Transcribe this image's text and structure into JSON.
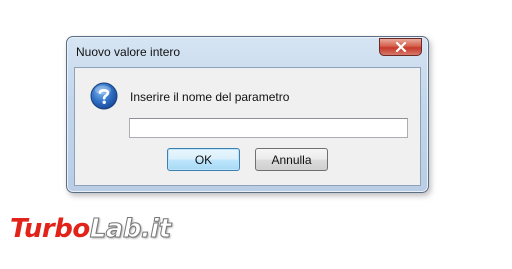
{
  "window": {
    "title": "Nuovo valore intero",
    "close_icon": "close-icon"
  },
  "dialog": {
    "icon": "question-icon",
    "prompt": "Inserire il nome del parametro",
    "input_value": "",
    "ok_label": "OK",
    "cancel_label": "Annulla"
  },
  "watermark": {
    "part1": "Turbo",
    "part2": "Lab.it"
  },
  "colors": {
    "accent": "#3c7fb1",
    "close_red": "#c4392a",
    "watermark_red": "#e2231a"
  }
}
